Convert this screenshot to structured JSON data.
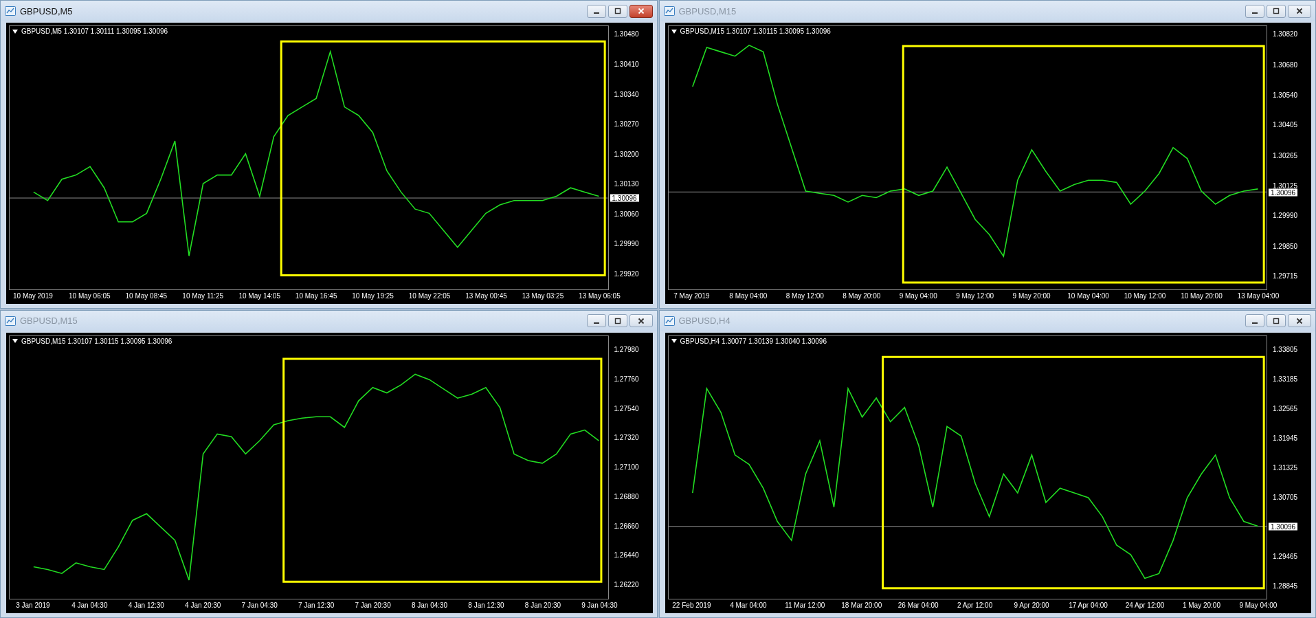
{
  "windows": [
    {
      "title": "GBPUSD,M5",
      "active": true,
      "info": "GBPUSD,M5  1.30107 1.30111 1.30095 1.30096",
      "chart_data": {
        "type": "line",
        "ylim": [
          1.29882,
          1.305
        ],
        "yticks": [
          {
            "value": 1.3048,
            "label": "1.30480"
          },
          {
            "value": 1.3041,
            "label": "1.30410"
          },
          {
            "value": 1.3034,
            "label": "1.30340"
          },
          {
            "value": 1.3027,
            "label": "1.30270"
          },
          {
            "value": 1.302,
            "label": "1.30200"
          },
          {
            "value": 1.3013,
            "label": "1.30130"
          },
          {
            "value": 1.3006,
            "label": "1.30060"
          },
          {
            "value": 1.2999,
            "label": "1.29990"
          },
          {
            "value": 1.2992,
            "label": "1.29920"
          }
        ],
        "categories": [
          "10 May 2019",
          null,
          null,
          null,
          "10 May 06:05",
          null,
          null,
          null,
          "10 May 08:45",
          null,
          null,
          null,
          "10 May 11:25",
          null,
          null,
          null,
          "10 May 14:05",
          null,
          null,
          null,
          "10 May 16:45",
          null,
          null,
          null,
          "10 May 19:25",
          null,
          null,
          null,
          "10 May 22:05",
          null,
          null,
          null,
          "13 May 00:45",
          null,
          null,
          null,
          "13 May 03:25",
          null,
          null,
          null,
          "13 May 06:05"
        ],
        "series": [
          {
            "color": "#22dd22",
            "values": [
              1.3011,
              1.3009,
              1.3014,
              1.3015,
              1.3017,
              1.3012,
              1.3004,
              1.3004,
              1.3006,
              1.3014,
              1.3023,
              1.2996,
              1.3013,
              1.3015,
              1.3015,
              1.302,
              1.301,
              1.3024,
              1.3029,
              1.3031,
              1.3033,
              1.3044,
              1.3031,
              1.3029,
              1.3025,
              1.3016,
              1.3011,
              1.3007,
              1.3006,
              1.3002,
              1.2998,
              1.3002,
              1.3006,
              1.3008,
              1.3009,
              1.3009,
              1.3009,
              1.301,
              1.3012,
              1.3011,
              1.301
            ]
          }
        ],
        "ref_lines": [
          {
            "axis": "y",
            "value": 1.30096,
            "label": "1.30096"
          }
        ]
      }
    },
    {
      "title": "GBPUSD,M15",
      "active": false,
      "info": "GBPUSD,M15  1.30107 1.30115 1.30095 1.30096",
      "chart_data": {
        "type": "line",
        "ylim": [
          1.2965,
          1.30858
        ],
        "yticks": [
          {
            "value": 1.3082,
            "label": "1.30820"
          },
          {
            "value": 1.3068,
            "label": "1.30680"
          },
          {
            "value": 1.3054,
            "label": "1.30540"
          },
          1.30405,
          1.30265,
          1.30125,
          {
            "value": 1.2999,
            "label": "1.29990"
          },
          {
            "value": 1.2985,
            "label": "1.29850"
          },
          1.29715
        ],
        "categories": [
          "7 May 2019",
          null,
          null,
          null,
          "8 May 04:00",
          null,
          null,
          null,
          "8 May 12:00",
          null,
          null,
          null,
          "8 May 20:00",
          null,
          null,
          null,
          "9 May 04:00",
          null,
          null,
          null,
          "9 May 12:00",
          null,
          null,
          null,
          "9 May 20:00",
          null,
          null,
          null,
          "10 May 04:00",
          null,
          null,
          null,
          "10 May 12:00",
          null,
          null,
          null,
          "10 May 20:00",
          null,
          null,
          null,
          "13 May 04:00"
        ],
        "series": [
          {
            "color": "#22dd22",
            "values": [
              1.3058,
              1.3076,
              1.3074,
              1.3072,
              1.3077,
              1.3074,
              1.305,
              1.303,
              1.301,
              1.3009,
              1.3008,
              1.3005,
              1.3008,
              1.3007,
              1.301,
              1.3011,
              1.3008,
              1.301,
              1.3021,
              1.3009,
              1.2997,
              1.299,
              1.298,
              1.3015,
              1.3029,
              1.3019,
              1.301,
              1.3013,
              1.3015,
              1.3015,
              1.3014,
              1.3004,
              1.301,
              1.3018,
              1.303,
              1.3025,
              1.301,
              1.3004,
              1.3008,
              1.301,
              1.3011
            ]
          }
        ],
        "ref_lines": [
          {
            "axis": "y",
            "value": 1.30096,
            "label": "1.30096"
          }
        ]
      }
    },
    {
      "title": "GBPUSD,M15",
      "active": false,
      "info": "GBPUSD,M15  1.30107 1.30115 1.30095 1.30096",
      "chart_data": {
        "type": "line",
        "ylim": [
          1.26107,
          1.28087
        ],
        "yticks": [
          {
            "value": 1.2798,
            "label": "1.27980"
          },
          {
            "value": 1.2776,
            "label": "1.27760"
          },
          {
            "value": 1.2754,
            "label": "1.27540"
          },
          {
            "value": 1.2732,
            "label": "1.27320"
          },
          {
            "value": 1.271,
            "label": "1.27100"
          },
          {
            "value": 1.2688,
            "label": "1.26880"
          },
          {
            "value": 1.2666,
            "label": "1.26660"
          },
          {
            "value": 1.2644,
            "label": "1.26440"
          },
          {
            "value": 1.2622,
            "label": "1.26220"
          }
        ],
        "categories": [
          "3 Jan 2019",
          null,
          null,
          null,
          "4 Jan 04:30",
          null,
          null,
          null,
          "4 Jan 12:30",
          null,
          null,
          null,
          "4 Jan 20:30",
          null,
          null,
          null,
          "7 Jan 04:30",
          null,
          null,
          null,
          "7 Jan 12:30",
          null,
          null,
          null,
          "7 Jan 20:30",
          null,
          null,
          null,
          "8 Jan 04:30",
          null,
          null,
          null,
          "8 Jan 12:30",
          null,
          null,
          null,
          "8 Jan 20:30",
          null,
          null,
          null,
          "9 Jan 04:30"
        ],
        "series": [
          {
            "color": "#22dd22",
            "values": [
              1.2635,
              1.2633,
              1.263,
              1.2638,
              1.2635,
              1.2633,
              1.265,
              1.267,
              1.2675,
              1.2665,
              1.2655,
              1.2625,
              1.272,
              1.2735,
              1.2733,
              1.272,
              1.273,
              1.2742,
              1.2745,
              1.2747,
              1.2748,
              1.2748,
              1.274,
              1.276,
              1.277,
              1.2766,
              1.2772,
              1.278,
              1.2776,
              1.2769,
              1.2762,
              1.2765,
              1.277,
              1.2755,
              1.272,
              1.2715,
              1.2713,
              1.272,
              1.2735,
              1.2738,
              1.273
            ]
          }
        ]
      }
    },
    {
      "title": "GBPUSD,H4",
      "active": false,
      "info": "GBPUSD,H4  1.30077 1.30139 1.30040 1.30096",
      "chart_data": {
        "type": "line",
        "ylim": [
          1.28563,
          1.34104
        ],
        "yticks": [
          1.33805,
          1.33185,
          1.32565,
          1.31945,
          1.31325,
          1.30705,
          1.29465,
          1.28845
        ],
        "categories": [
          "22 Feb 2019",
          null,
          null,
          null,
          "4 Mar 04:00",
          null,
          null,
          null,
          "11 Mar 12:00",
          null,
          null,
          null,
          "18 Mar 20:00",
          null,
          null,
          null,
          "26 Mar 04:00",
          null,
          null,
          null,
          "2 Apr 12:00",
          null,
          null,
          null,
          "9 Apr 20:00",
          null,
          null,
          null,
          "17 Apr 04:00",
          null,
          null,
          null,
          "24 Apr 12:00",
          null,
          null,
          null,
          "1 May 20:00",
          null,
          null,
          null,
          "9 May 04:00"
        ],
        "series": [
          {
            "color": "#22dd22",
            "values": [
              1.308,
              1.33,
              1.325,
              1.316,
              1.314,
              1.309,
              1.302,
              1.298,
              1.312,
              1.319,
              1.305,
              1.33,
              1.324,
              1.328,
              1.323,
              1.326,
              1.318,
              1.305,
              1.322,
              1.32,
              1.31,
              1.303,
              1.312,
              1.308,
              1.316,
              1.306,
              1.309,
              1.308,
              1.307,
              1.303,
              1.297,
              1.295,
              1.29,
              1.291,
              1.298,
              1.307,
              1.312,
              1.316,
              1.307,
              1.302,
              1.301
            ]
          }
        ],
        "ref_lines": [
          {
            "axis": "y",
            "value": 1.30096,
            "label": "1.30096"
          }
        ]
      }
    }
  ]
}
